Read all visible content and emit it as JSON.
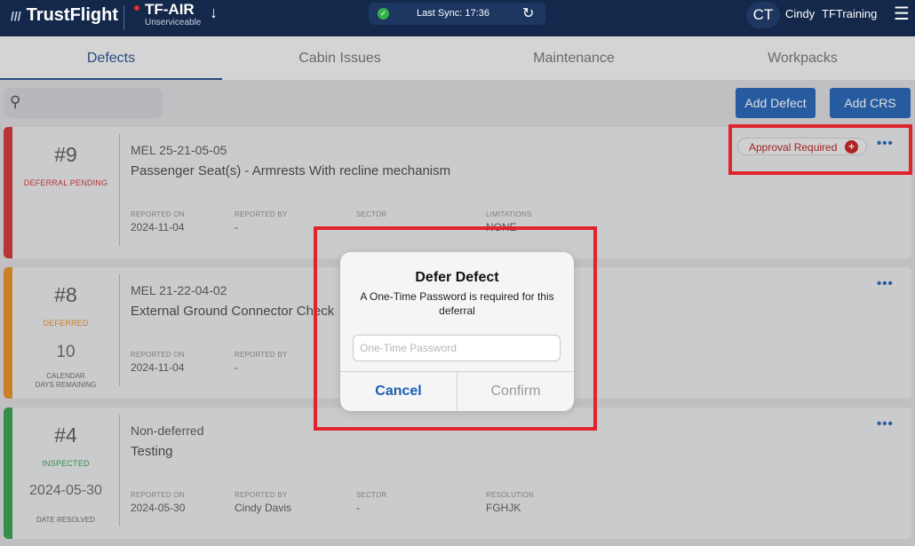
{
  "header": {
    "logo_text": "TrustFlight",
    "aircraft_reg": "TF-AIR",
    "aircraft_status": "Unserviceable",
    "sync_text": "Last Sync: 17:36",
    "avatar_initials": "CT",
    "user_first": "Cindy",
    "user_last": "TFTraining"
  },
  "tabs": [
    {
      "label": "Defects"
    },
    {
      "label": "Cabin Issues"
    },
    {
      "label": "Maintenance"
    },
    {
      "label": "Workpacks"
    }
  ],
  "toolbar": {
    "add_defect_label": "Add Defect",
    "add_crs_label": "Add CRS"
  },
  "defects": [
    {
      "number": "#9",
      "status": "DEFERRAL PENDING",
      "type": "MEL  25-21-05-05",
      "title": "Passenger Seat(s) - Armrests With recline mechanism",
      "reported_on_label": "REPORTED ON",
      "reported_on": "2024-11-04",
      "reported_by_label": "REPORTED BY",
      "reported_by": "-",
      "sector_label": "SECTOR",
      "limitations_label": "LIMITATIONS",
      "limitations": "NONE",
      "badge": "Approval Required",
      "status_color": "#d32f2f"
    },
    {
      "number": "#8",
      "status": "DEFERRED",
      "days": "10",
      "days_label_1": "CALENDAR",
      "days_label_2": "DAYS REMAINING",
      "type": "MEL  21-22-04-02",
      "title": "External Ground Connector Check",
      "reported_on_label": "REPORTED ON",
      "reported_on": "2024-11-04",
      "reported_by_label": "REPORTED BY",
      "reported_by": "-",
      "status_color": "#e58a1f"
    },
    {
      "number": "#4",
      "status": "INSPECTED",
      "date_resolved": "2024-05-30",
      "date_resolved_label": "DATE RESOLVED",
      "type": "Non-deferred",
      "title": "Testing",
      "reported_on_label": "REPORTED ON",
      "reported_on": "2024-05-30",
      "reported_by_label": "REPORTED BY",
      "reported_by": "Cindy Davis",
      "sector_label": "SECTOR",
      "sector": "-",
      "resolution_label": "RESOLUTION",
      "resolution": "FGHJK",
      "status_color": "#2e9e4a"
    }
  ],
  "dialog": {
    "title": "Defer Defect",
    "message": "A One-Time Password is required for this deferral",
    "input_placeholder": "One-Time Password",
    "input_value": "",
    "cancel_label": "Cancel",
    "confirm_label": "Confirm"
  },
  "colors": {
    "header_bg": "#13284a",
    "accent": "#1f5fb3",
    "highlight": "#e1242b"
  }
}
